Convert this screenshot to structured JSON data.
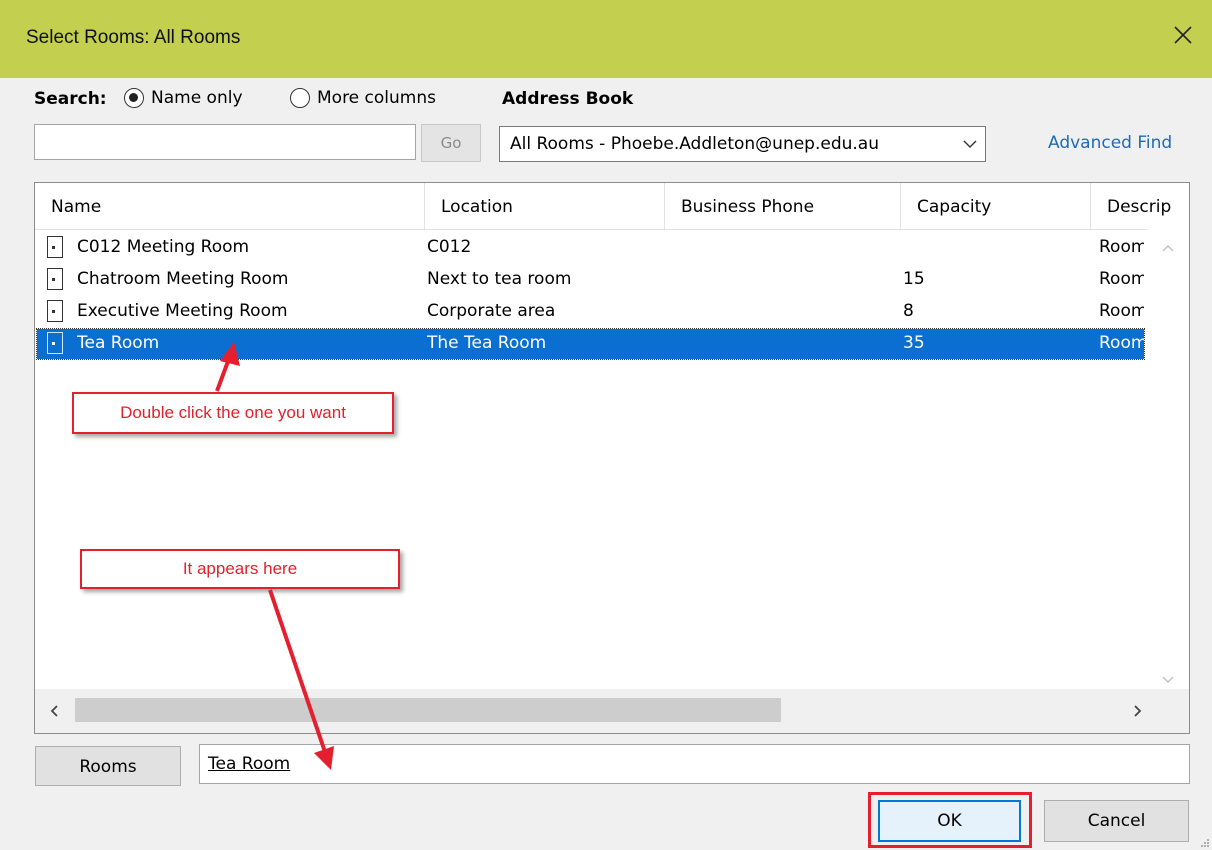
{
  "window": {
    "title": "Select Rooms: All Rooms"
  },
  "search": {
    "label": "Search:",
    "options": [
      "Name only",
      "More columns"
    ],
    "selected": "Name only",
    "input_value": "",
    "go_label": "Go"
  },
  "address_book": {
    "label": "Address Book",
    "selected": "All Rooms - Phoebe.Addleton@unep.edu.au",
    "advanced_find": "Advanced Find"
  },
  "table": {
    "columns": [
      "Name",
      "Location",
      "Business Phone",
      "Capacity",
      "Descrip"
    ],
    "rows": [
      {
        "name": "C012 Meeting Room",
        "location": "C012",
        "phone": "",
        "capacity": "",
        "description": "Room"
      },
      {
        "name": "Chatroom Meeting Room",
        "location": "Next to tea room",
        "phone": "",
        "capacity": "15",
        "description": "Room"
      },
      {
        "name": "Executive Meeting Room",
        "location": "Corporate area",
        "phone": "",
        "capacity": "8",
        "description": "Room"
      },
      {
        "name": "Tea Room",
        "location": "The Tea Room",
        "phone": "",
        "capacity": "35",
        "description": "Room"
      }
    ],
    "selected_row": 3
  },
  "rooms": {
    "button_label": "Rooms",
    "value": "Tea Room"
  },
  "buttons": {
    "ok": "OK",
    "cancel": "Cancel"
  },
  "annotations": {
    "double_click": "Double click the one you want",
    "appears_here": "It appears here"
  },
  "colors": {
    "titlebar": "#c3cf4f",
    "selection": "#0a6fd0",
    "annotation": "#e4202f",
    "link": "#1e6ab4"
  }
}
